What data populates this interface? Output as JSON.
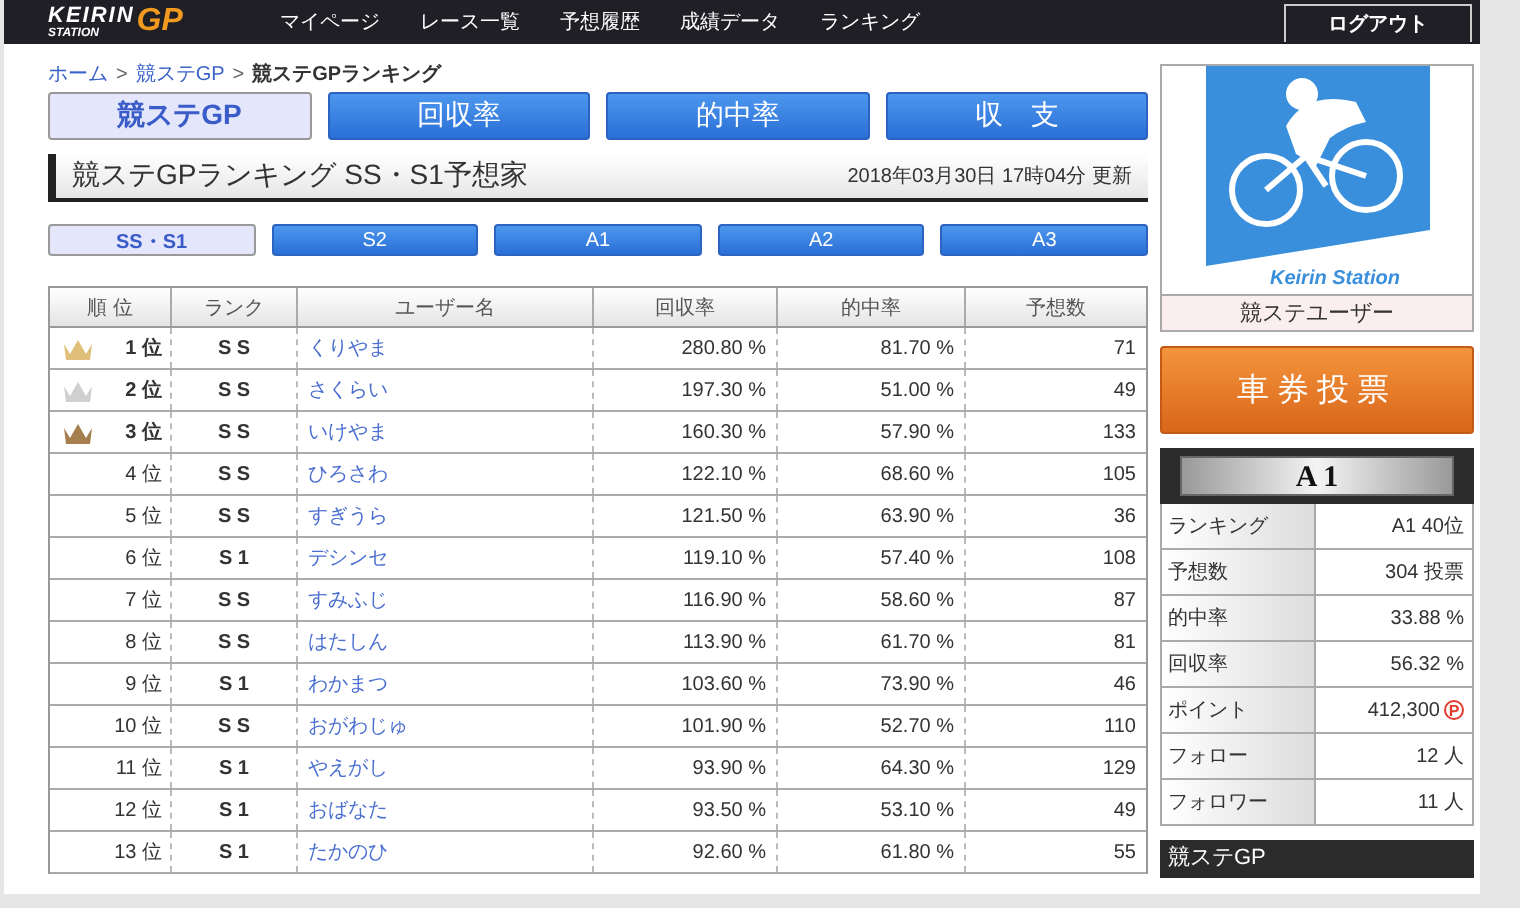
{
  "header": {
    "logo": {
      "top": "KEIRIN",
      "bottom": "STATION",
      "mark": "GP"
    },
    "nav": [
      "マイページ",
      "レース一覧",
      "予想履歴",
      "成績データ",
      "ランキング"
    ],
    "logout": "ログアウト"
  },
  "breadcrumb_separator": ">",
  "breadcrumb": [
    {
      "label": "ホーム",
      "link": true
    },
    {
      "label": "競ステGP",
      "link": true
    },
    {
      "label": "競ステGPランキング",
      "link": false
    }
  ],
  "tabs": [
    {
      "label": "競ステGP",
      "selected": true
    },
    {
      "label": "回収率",
      "selected": false
    },
    {
      "label": "的中率",
      "selected": false
    },
    {
      "label": "収　支",
      "selected": false
    }
  ],
  "heading": {
    "title": "競ステGPランキング SS・S1予想家",
    "updated": "2018年03月30日 17時04分 更新"
  },
  "class_tabs": [
    {
      "label": "SS・S1",
      "selected": true
    },
    {
      "label": "S2",
      "selected": false
    },
    {
      "label": "A1",
      "selected": false
    },
    {
      "label": "A2",
      "selected": false
    },
    {
      "label": "A3",
      "selected": false
    }
  ],
  "table": {
    "columns": [
      "順 位",
      "ランク",
      "ユーザー名",
      "回収率",
      "的中率",
      "予想数"
    ],
    "rows": [
      {
        "rank": "1 位",
        "class": "S S",
        "user": "くりやま",
        "recovery": "280.80 %",
        "hit": "81.70 %",
        "count": "71",
        "color": "#e0bf7a"
      },
      {
        "rank": "2 位",
        "class": "S S",
        "user": "さくらい",
        "recovery": "197.30 %",
        "hit": "51.00 %",
        "count": "49",
        "color": "#cfcfcf"
      },
      {
        "rank": "3 位",
        "class": "S S",
        "user": "いけやま",
        "recovery": "160.30 %",
        "hit": "57.90 %",
        "count": "133",
        "color": "#a57f4e"
      },
      {
        "rank": "4 位",
        "class": "S S",
        "user": "ひろさわ",
        "recovery": "122.10 %",
        "hit": "68.60 %",
        "count": "105"
      },
      {
        "rank": "5 位",
        "class": "S S",
        "user": "すぎうら",
        "recovery": "121.50 %",
        "hit": "63.90 %",
        "count": "36"
      },
      {
        "rank": "6 位",
        "class": "S 1",
        "user": "デシンセ",
        "recovery": "119.10 %",
        "hit": "57.40 %",
        "count": "108"
      },
      {
        "rank": "7 位",
        "class": "S S",
        "user": "すみふじ",
        "recovery": "116.90 %",
        "hit": "58.60 %",
        "count": "87"
      },
      {
        "rank": "8 位",
        "class": "S S",
        "user": "はたしん",
        "recovery": "113.90 %",
        "hit": "61.70 %",
        "count": "81"
      },
      {
        "rank": "9 位",
        "class": "S 1",
        "user": "わかまつ",
        "recovery": "103.60 %",
        "hit": "73.90 %",
        "count": "46"
      },
      {
        "rank": "10 位",
        "class": "S S",
        "user": "おがわじゅ",
        "recovery": "101.90 %",
        "hit": "52.70 %",
        "count": "110"
      },
      {
        "rank": "11 位",
        "class": "S 1",
        "user": "やえがし",
        "recovery": "93.90 %",
        "hit": "64.30 %",
        "count": "129"
      },
      {
        "rank": "12 位",
        "class": "S 1",
        "user": "おばなた",
        "recovery": "93.50 %",
        "hit": "53.10 %",
        "count": "49"
      },
      {
        "rank": "13 位",
        "class": "S 1",
        "user": "たかのひ",
        "recovery": "92.60 %",
        "hit": "61.80 %",
        "count": "55"
      }
    ]
  },
  "sidebar": {
    "profile": {
      "logo_text": "Keirin Station",
      "name": "競ステユーザー"
    },
    "vote_button": "車券投票",
    "stats": {
      "grade": "A 1",
      "rows": [
        {
          "label": "ランキング",
          "value": "A1 40位"
        },
        {
          "label": "予想数",
          "value": "304 投票"
        },
        {
          "label": "的中率",
          "value": "33.88 %"
        },
        {
          "label": "回収率",
          "value": "56.32 %"
        },
        {
          "label": "ポイント",
          "value": "412,300",
          "badge": "P"
        },
        {
          "label": "フォロー",
          "value": "12 人"
        },
        {
          "label": "フォロワー",
          "value": "11 人"
        }
      ]
    },
    "menu": {
      "title": "競ステGP"
    }
  }
}
